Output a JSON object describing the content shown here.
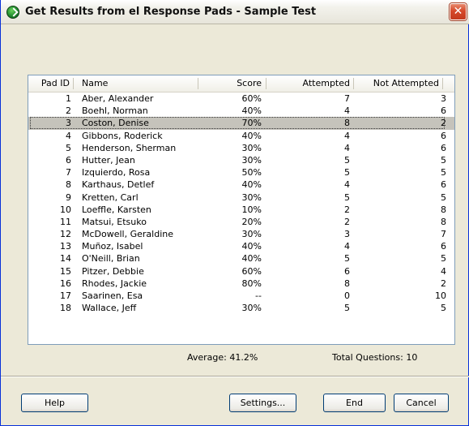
{
  "window": {
    "title": "Get Results from el Response Pads - Sample Test",
    "close_glyph": "✕"
  },
  "table": {
    "columns": [
      "Pad ID",
      "Name",
      "Score",
      "Attempted",
      "Not Attempted"
    ],
    "rows": [
      {
        "id": "1",
        "name": "Aber, Alexander",
        "score": "60%",
        "attempted": "7",
        "not_attempted": "3"
      },
      {
        "id": "2",
        "name": "Boehl, Norman",
        "score": "40%",
        "attempted": "4",
        "not_attempted": "6"
      },
      {
        "id": "3",
        "name": "Coston, Denise",
        "score": "70%",
        "attempted": "8",
        "not_attempted": "2"
      },
      {
        "id": "4",
        "name": "Gibbons, Roderick",
        "score": "40%",
        "attempted": "4",
        "not_attempted": "6"
      },
      {
        "id": "5",
        "name": "Henderson, Sherman",
        "score": "30%",
        "attempted": "4",
        "not_attempted": "6"
      },
      {
        "id": "6",
        "name": "Hutter, Jean",
        "score": "30%",
        "attempted": "5",
        "not_attempted": "5"
      },
      {
        "id": "7",
        "name": "Izquierdo, Rosa",
        "score": "50%",
        "attempted": "5",
        "not_attempted": "5"
      },
      {
        "id": "8",
        "name": "Karthaus, Detlef",
        "score": "40%",
        "attempted": "4",
        "not_attempted": "6"
      },
      {
        "id": "9",
        "name": "Kretten, Carl",
        "score": "30%",
        "attempted": "5",
        "not_attempted": "5"
      },
      {
        "id": "10",
        "name": "Loeffle, Karsten",
        "score": "10%",
        "attempted": "2",
        "not_attempted": "8"
      },
      {
        "id": "11",
        "name": "Matsui, Etsuko",
        "score": "20%",
        "attempted": "2",
        "not_attempted": "8"
      },
      {
        "id": "12",
        "name": "McDowell, Geraldine",
        "score": "30%",
        "attempted": "3",
        "not_attempted": "7"
      },
      {
        "id": "13",
        "name": "Muñoz, Isabel",
        "score": "40%",
        "attempted": "4",
        "not_attempted": "6"
      },
      {
        "id": "14",
        "name": "O'Neill, Brian",
        "score": "40%",
        "attempted": "5",
        "not_attempted": "5"
      },
      {
        "id": "15",
        "name": "Pitzer, Debbie",
        "score": "60%",
        "attempted": "6",
        "not_attempted": "4"
      },
      {
        "id": "16",
        "name": "Rhodes, Jackie",
        "score": "80%",
        "attempted": "8",
        "not_attempted": "2"
      },
      {
        "id": "17",
        "name": "Saarinen, Esa",
        "score": "--",
        "attempted": "0",
        "not_attempted": "10"
      },
      {
        "id": "18",
        "name": "Wallace, Jeff",
        "score": "30%",
        "attempted": "5",
        "not_attempted": "5"
      }
    ],
    "selected_index": 2
  },
  "summary": {
    "average": "Average: 41.2%",
    "total_questions": "Total Questions: 10"
  },
  "buttons": {
    "help": "Help",
    "settings": "Settings...",
    "end": "End",
    "cancel": "Cancel"
  },
  "colors": {
    "titlebar_text": "#111111",
    "selection": "#c5c3bb",
    "close_button": "#d6492a"
  }
}
